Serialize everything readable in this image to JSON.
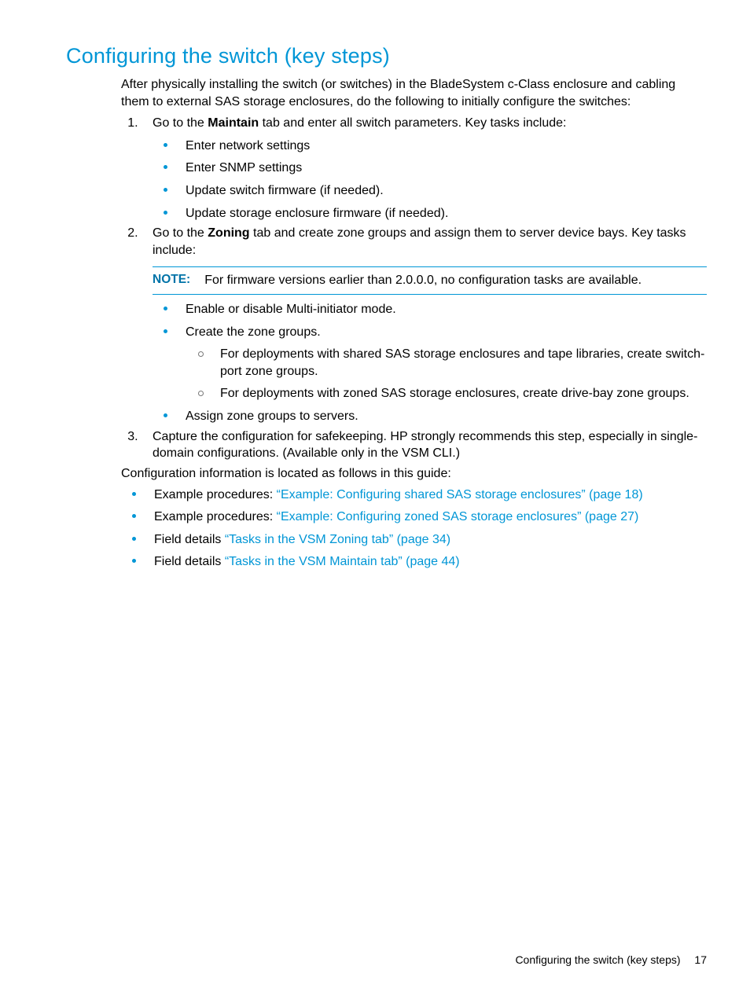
{
  "title": "Configuring the switch (key steps)",
  "intro": "After physically installing the switch (or switches) in the BladeSystem c-Class enclosure and cabling them to external SAS storage enclosures, do the following to initially configure the switches:",
  "step1": {
    "pre": "Go to the ",
    "bold": "Maintain",
    "post": " tab and enter all switch parameters. Key tasks include:",
    "items": [
      "Enter network settings",
      "Enter SNMP settings",
      "Update switch firmware (if needed).",
      "Update storage enclosure firmware (if needed)."
    ]
  },
  "step2": {
    "pre": "Go to the ",
    "bold": "Zoning",
    "post": " tab and create zone groups and assign them to server device bays. Key tasks include:",
    "note_label": "NOTE:",
    "note_text": "For firmware versions earlier than 2.0.0.0, no configuration tasks are available.",
    "item1": "Enable or disable Multi-initiator mode.",
    "item2": "Create the zone groups.",
    "sub1": "For deployments with shared SAS storage enclosures and tape libraries, create switch-port zone groups.",
    "sub2": "For deployments with zoned SAS storage enclosures, create drive-bay zone groups.",
    "item3": "Assign zone groups to servers."
  },
  "step3": "Capture the configuration for safekeeping. HP strongly recommends this step, especially in single-domain configurations. (Available only in the VSM CLI.)",
  "outro": "Configuration information is located as follows in this guide:",
  "refs": [
    {
      "prefix": "Example procedures: ",
      "link": "“Example: Configuring shared SAS storage enclosures” (page 18)"
    },
    {
      "prefix": "Example procedures: ",
      "link": "“Example: Configuring zoned SAS storage enclosures” (page 27)"
    },
    {
      "prefix": "Field details ",
      "link": "“Tasks in the VSM Zoning tab” (page 34)"
    },
    {
      "prefix": "Field details ",
      "link": "“Tasks in the VSM Maintain tab” (page 44)"
    }
  ],
  "footer_title": "Configuring the switch (key steps)",
  "page_number": "17"
}
